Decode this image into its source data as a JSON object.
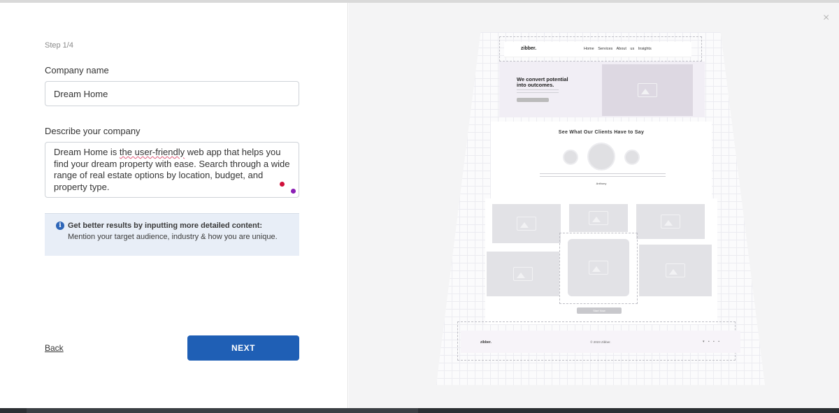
{
  "form": {
    "step": "Step 1/4",
    "company_label": "Company name",
    "company_value": "Dream Home",
    "describe_label": "Describe your company",
    "describe_pre": "Dream Home is ",
    "describe_underlined": "the user-friendly",
    "describe_post": " web app that helps you find your dream property with ease. Search through a wide range of real estate options by location, budget, and property type.",
    "tip_title": "Get better results by inputting more detailed content:",
    "tip_body": "Mention your target audience, industry & how you are unique.",
    "back_label": "Back",
    "next_label": "NEXT"
  },
  "preview": {
    "close_glyph": "×",
    "logo": "zibber.",
    "nav_items": "Home Services About us Insights",
    "hero_heading_1": "We convert potential",
    "hero_heading_2": "into outcomes.",
    "testimonials_title": "See What Our Clients Have to Say",
    "testimonial_name": "Anthony",
    "cta_label": "Start Now",
    "footer_logo": "zibber.",
    "footer_copy": "© 2023 Zibber.",
    "footer_icons": "▾ ▪ ▪ ▪"
  },
  "colors": {
    "primary_button": "#1f5fb5",
    "tip_background": "#e8eef7",
    "info_icon": "#2e66b8",
    "grammar_dot_red": "#d0103a",
    "grammar_dot_purple": "#8b1fb5"
  }
}
